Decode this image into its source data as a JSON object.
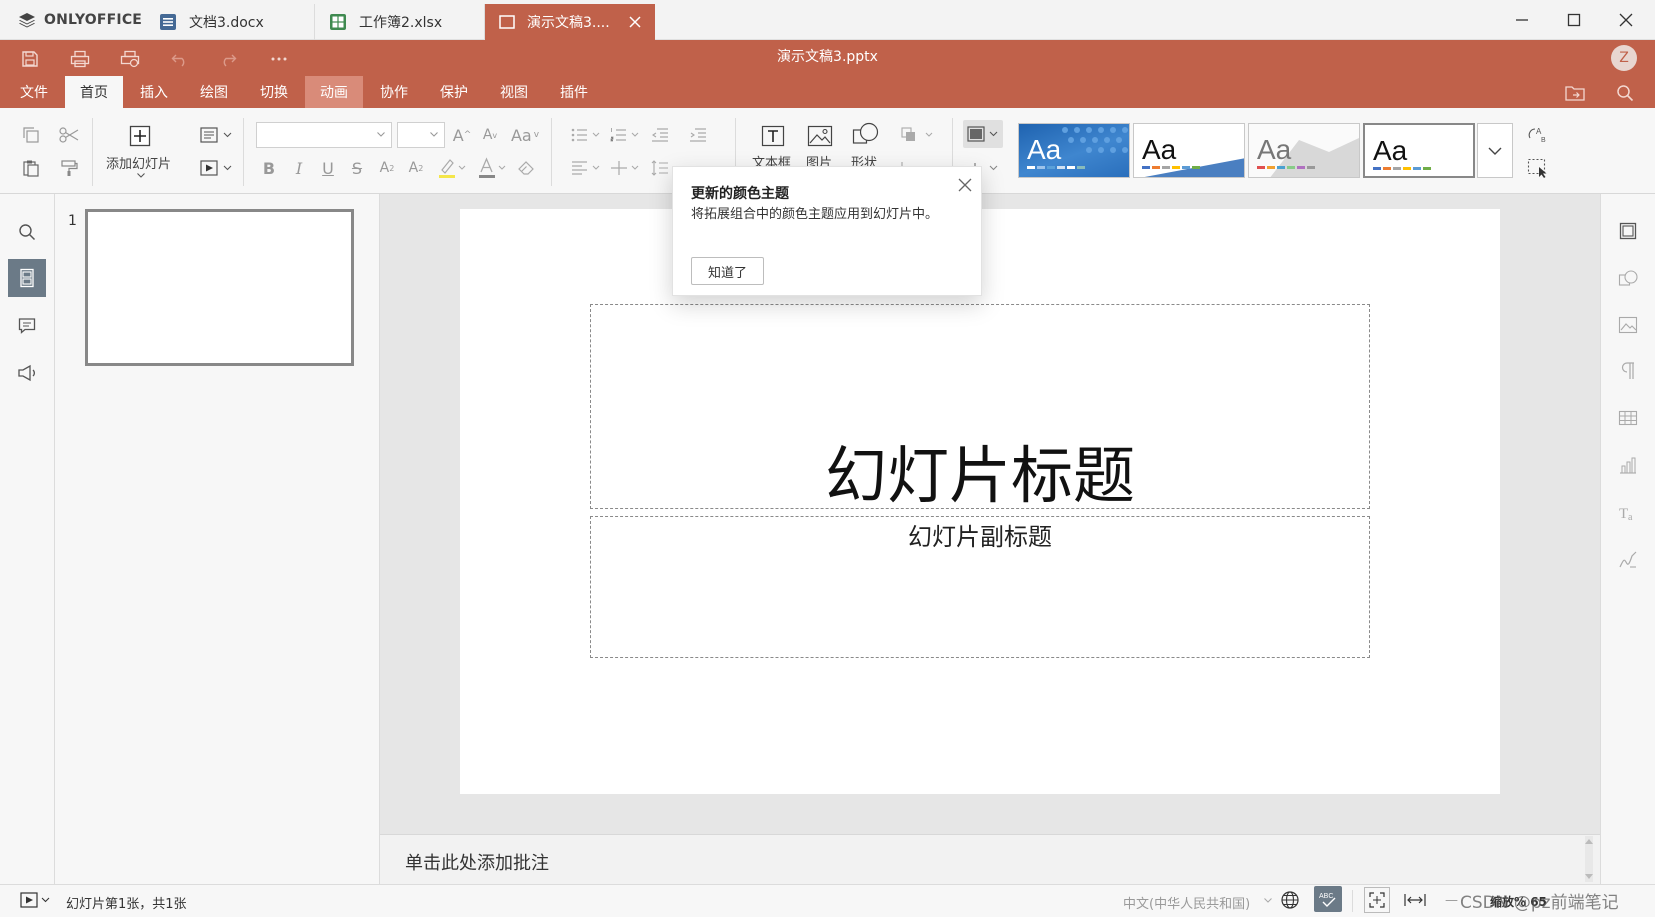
{
  "brand": {
    "name": "ONLYOFFICE"
  },
  "doc_tabs": [
    {
      "label": "文档3.docx",
      "icon": "document-icon"
    },
    {
      "label": "工作簿2.xlsx",
      "icon": "spreadsheet-icon"
    },
    {
      "label": "演示文稿3....",
      "icon": "presentation-icon",
      "active": true
    }
  ],
  "header": {
    "title": "演示文稿3.pptx",
    "avatar": "Z"
  },
  "menu": [
    "文件",
    "首页",
    "插入",
    "绘图",
    "切换",
    "动画",
    "协作",
    "保护",
    "视图",
    "插件"
  ],
  "menu_active": "首页",
  "menu_highlight": "动画",
  "ribbon": {
    "add_slide": "添加幻灯片",
    "textbox": "文本框",
    "picture": "图片",
    "shape": "形状",
    "themes": [
      "Aa",
      "Aa",
      "Aa",
      "Aa"
    ]
  },
  "popup": {
    "title": "更新的颜色主题",
    "body": "将拓展组合中的颜色主题应用到幻灯片中。",
    "button": "知道了"
  },
  "slides_panel": {
    "slide_number": "1"
  },
  "slide": {
    "title": "幻灯片标题",
    "subtitle": "幻灯片副标题"
  },
  "notes": {
    "placeholder": "单击此处添加批注"
  },
  "status": {
    "slide_info": "幻灯片第1张，共1张",
    "language": "中文(中华人民共和国)",
    "zoom": "缩放% 65",
    "watermark": "CSDN @pz前端笔记"
  },
  "colors": {
    "accent": "#c0614a",
    "accent_light": "#d98b79"
  }
}
